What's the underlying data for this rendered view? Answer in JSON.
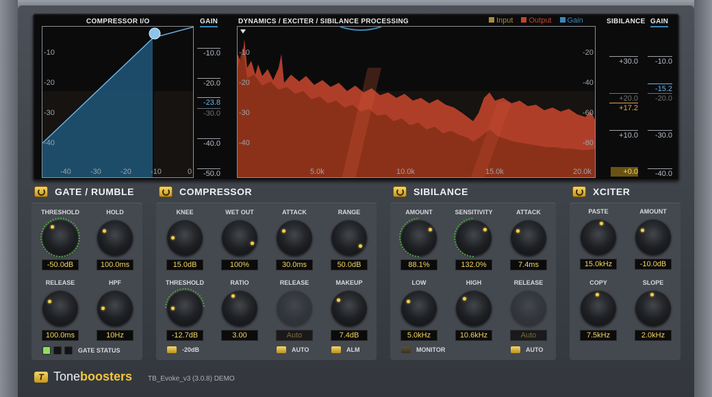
{
  "display": {
    "compressor_title": "COMPRESSOR I/O",
    "gain_label": "GAIN",
    "dynamics_title": "DYNAMICS / EXCITER / SIBILANCE PROCESSING",
    "sibilance_label": "SIBILANCE",
    "gain_label_2": "GAIN",
    "legend": [
      {
        "label": "Input",
        "color": "#a98a3a"
      },
      {
        "label": "Output",
        "color": "#c0442c"
      },
      {
        "label": "Gain",
        "color": "#3b87b8"
      }
    ],
    "comp_yticks": [
      "-10",
      "-20",
      "-30",
      "-40"
    ],
    "comp_xticks": [
      "-40",
      "-30",
      "-20",
      "-10",
      "0"
    ],
    "comp_gain_ticks": [
      "-10.0",
      "-20.0",
      "-23.8",
      "-30.0",
      "-40.0",
      "-50.0"
    ],
    "spec_yticks_left": [
      "-10",
      "-20",
      "-30",
      "-40"
    ],
    "spec_yticks_right": [
      "-20",
      "-40",
      "-60",
      "-80"
    ],
    "spec_xticks": [
      "5.0k",
      "10.0k",
      "15.0k",
      "20.0k"
    ],
    "sib_ticks": [
      "+30.0",
      "+20.0",
      "+17.2",
      "+10.0",
      "+0.0"
    ],
    "gain2_ticks": [
      "-10.0",
      "-15.2",
      "-20.0",
      "-30.0",
      "-40.0"
    ]
  },
  "sections": {
    "gate": {
      "title": "GATE / RUMBLE",
      "controls": [
        {
          "label": "THRESHOLD",
          "value": "-50.0dB"
        },
        {
          "label": "HOLD",
          "value": "100.0ms"
        },
        {
          "label": "RELEASE",
          "value": "100.0ms"
        },
        {
          "label": "HPF",
          "value": "10Hz"
        }
      ],
      "status_label": "GATE STATUS"
    },
    "compressor": {
      "title": "COMPRESSOR",
      "controls": [
        {
          "label": "KNEE",
          "value": "15.0dB"
        },
        {
          "label": "WET OUT",
          "value": "100%"
        },
        {
          "label": "ATTACK",
          "value": "30.0ms"
        },
        {
          "label": "RANGE",
          "value": "50.0dB"
        },
        {
          "label": "THRESHOLD",
          "value": "-12.7dB"
        },
        {
          "label": "RATIO",
          "value": "3.00"
        },
        {
          "label": "RELEASE",
          "value": "Auto"
        },
        {
          "label": "MAKEUP",
          "value": "7.4dB"
        }
      ],
      "toggle_20db": "-20dB",
      "toggle_auto": "AUTO",
      "toggle_alm": "ALM"
    },
    "sibilance": {
      "title": "SIBILANCE",
      "controls": [
        {
          "label": "AMOUNT",
          "value": "88.1%"
        },
        {
          "label": "SENSITIVITY",
          "value": "132.0%"
        },
        {
          "label": "ATTACK",
          "value": "7.4ms"
        },
        {
          "label": "LOW",
          "value": "5.0kHz"
        },
        {
          "label": "HIGH",
          "value": "10.6kHz"
        },
        {
          "label": "RELEASE",
          "value": "Auto"
        }
      ],
      "toggle_monitor": "MONITOR",
      "toggle_auto": "AUTO"
    },
    "xciter": {
      "title": "XCITER",
      "controls": [
        {
          "label": "PASTE",
          "value": "15.0kHz"
        },
        {
          "label": "AMOUNT",
          "value": "-10.0dB"
        },
        {
          "label": "COPY",
          "value": "7.5kHz"
        },
        {
          "label": "SLOPE",
          "value": "2.0kHz"
        }
      ]
    }
  },
  "footer": {
    "logo_letter": "T",
    "brand_plain": "Tone",
    "brand_bold": "boosters",
    "version": "TB_Evoke_v3 (3.0.8) DEMO"
  },
  "colors": {
    "accent_gold": "#f2c63c",
    "display_blue": "#3b87b8",
    "spectrum_output": "#c0442c"
  }
}
